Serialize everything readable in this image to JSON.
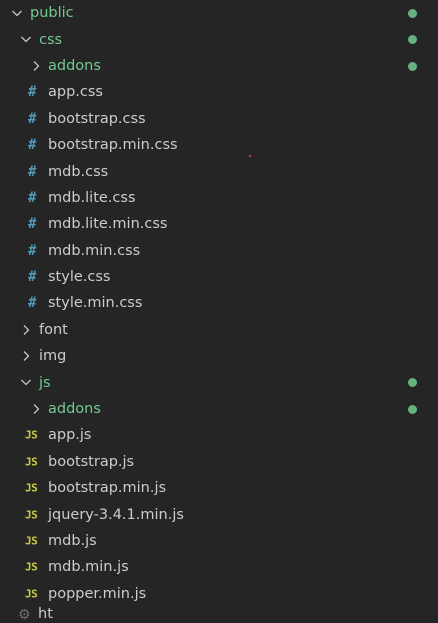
{
  "colors": {
    "background": "#252526",
    "text": "#cccccc",
    "modified_green": "#73c991",
    "css_icon": "#519aba",
    "js_icon": "#cbcb41"
  },
  "icons": {
    "expanded": "chevron-down-icon",
    "collapsed": "chevron-right-icon",
    "css_file": "hash-css-icon",
    "js_file": "js-file-icon"
  },
  "tree": {
    "public": {
      "label": "public",
      "expanded": true,
      "status": "modified"
    },
    "css": {
      "label": "css",
      "expanded": true,
      "status": "modified"
    },
    "css_addons": {
      "label": "addons",
      "expanded": false,
      "status": "modified"
    },
    "css_files": [
      {
        "label": "app.css",
        "icon": "#"
      },
      {
        "label": "bootstrap.css",
        "icon": "#"
      },
      {
        "label": "bootstrap.min.css",
        "icon": "#"
      },
      {
        "label": "mdb.css",
        "icon": "#"
      },
      {
        "label": "mdb.lite.css",
        "icon": "#"
      },
      {
        "label": "mdb.lite.min.css",
        "icon": "#"
      },
      {
        "label": "mdb.min.css",
        "icon": "#"
      },
      {
        "label": "style.css",
        "icon": "#"
      },
      {
        "label": "style.min.css",
        "icon": "#"
      }
    ],
    "font": {
      "label": "font",
      "expanded": false
    },
    "img": {
      "label": "img",
      "expanded": false
    },
    "js": {
      "label": "js",
      "expanded": true,
      "status": "modified"
    },
    "js_addons": {
      "label": "addons",
      "expanded": false,
      "status": "modified"
    },
    "js_files": [
      {
        "label": "app.js",
        "icon": "JS"
      },
      {
        "label": "bootstrap.js",
        "icon": "JS"
      },
      {
        "label": "bootstrap.min.js",
        "icon": "JS"
      },
      {
        "label": "jquery-3.4.1.min.js",
        "icon": "JS"
      },
      {
        "label": "mdb.js",
        "icon": "JS"
      },
      {
        "label": "mdb.min.js",
        "icon": "JS"
      },
      {
        "label": "popper.min.js",
        "icon": "JS"
      }
    ],
    "partial_next": {
      "label": "ht"
    }
  }
}
